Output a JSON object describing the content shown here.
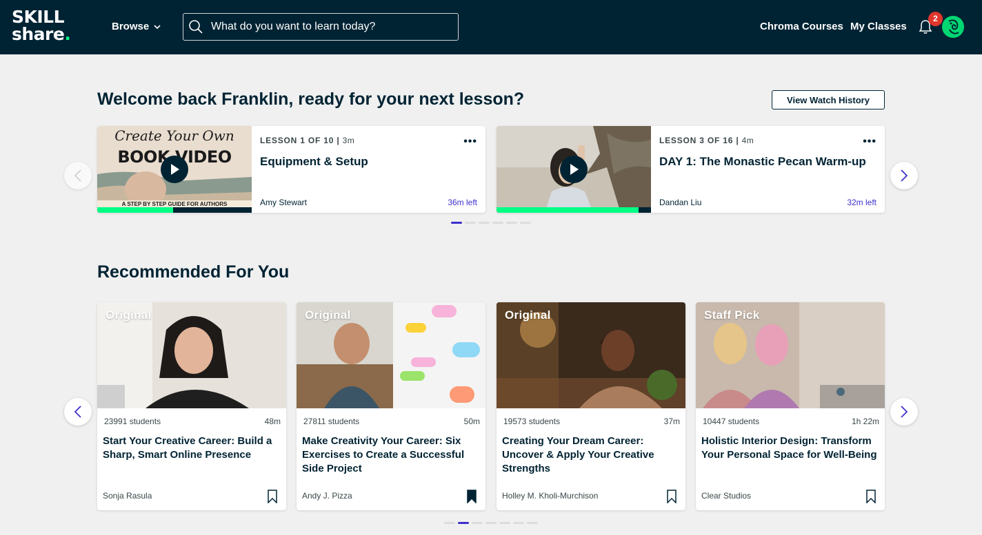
{
  "header": {
    "logo_line1": "SKILL",
    "logo_line2": "share",
    "browse_label": "Browse",
    "search_placeholder": "What do you want to learn today?",
    "nav_links": [
      "Chroma Courses",
      "My Classes"
    ],
    "notification_count": "2"
  },
  "continue": {
    "title": "Welcome back Franklin, ready for your next lesson?",
    "watch_history_label": "View Watch History",
    "cards": [
      {
        "lesson": "LESSON 1 OF 10",
        "duration": "3m",
        "title": "Equipment & Setup",
        "teacher": "Amy Stewart",
        "time_left": "36m left",
        "progress": 0.49,
        "thumb_text_line1": "Create Your Own",
        "thumb_text_line2": "BOOK VIDEO",
        "thumb_caption": "A STEP BY STEP GUIDE FOR AUTHORS"
      },
      {
        "lesson": "LESSON 3 OF 16",
        "duration": "4m",
        "title": "DAY 1: The Monastic Pecan Warm-up",
        "teacher": "Dandan Liu",
        "time_left": "32m left",
        "progress": 0.92
      }
    ],
    "pagination": {
      "count": 6,
      "active": 0
    }
  },
  "recommended": {
    "title": "Recommended For You",
    "cards": [
      {
        "tag": "Original",
        "students": "23991 students",
        "duration": "48m",
        "title": "Start Your Creative Career: Build a Sharp, Smart Online Presence",
        "teacher": "Sonja Rasula",
        "saved": false
      },
      {
        "tag": "Original",
        "students": "27811 students",
        "duration": "50m",
        "title": "Make Creativity Your Career: Six Exercises to Create a Successful Side Project",
        "teacher": "Andy J. Pizza",
        "saved": true
      },
      {
        "tag": "Original",
        "students": "19573 students",
        "duration": "37m",
        "title": "Creating Your Dream Career: Uncover & Apply Your Creative Strengths",
        "teacher": "Holley M. Kholi-Murchison",
        "saved": false
      },
      {
        "tag": "Staff Pick",
        "students": "10447 students",
        "duration": "1h 22m",
        "title": "Holistic Interior Design: Transform Your Personal Space for Well-Being",
        "teacher": "Clear Studios",
        "saved": false
      }
    ],
    "pagination": {
      "count": 7,
      "active": 1
    }
  },
  "colors": {
    "navy": "#002333",
    "green": "#00ff84",
    "purple": "#3d30cc",
    "badge_red": "#e0362d"
  },
  "icons": [
    "search-icon",
    "chevron-down-icon",
    "bell-icon",
    "play-icon",
    "bookmark-icon",
    "chevron-left-icon",
    "chevron-right-icon",
    "more-icon"
  ]
}
